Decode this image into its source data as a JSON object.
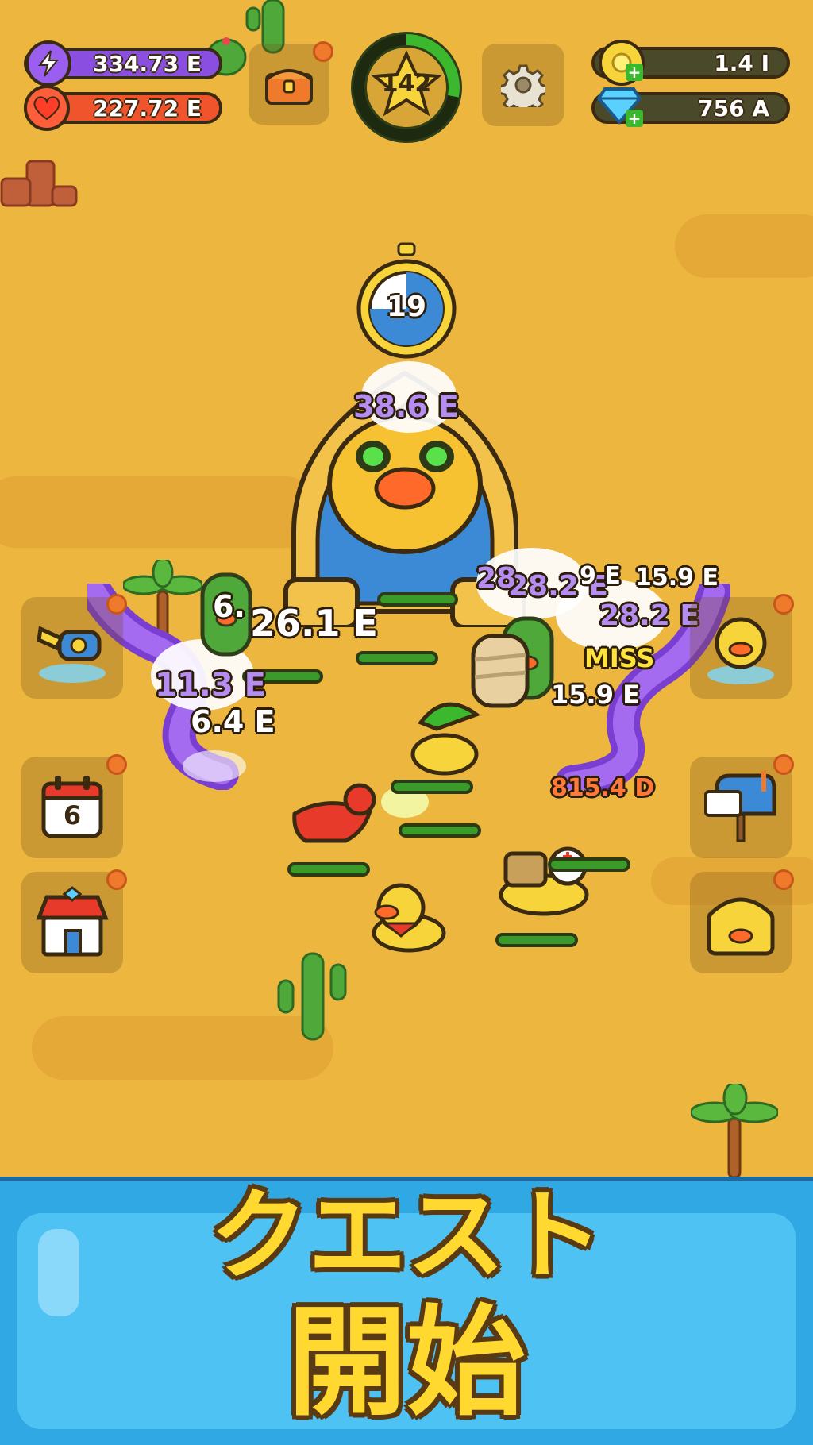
{
  "hud": {
    "energy": {
      "value": "334.73 E",
      "icon": "lightning-icon",
      "color": "#8a4ee0"
    },
    "health": {
      "value": "227.72 E",
      "icon": "heart-icon",
      "color": "#f0542c"
    },
    "level": {
      "value": "142",
      "progress": 0.28,
      "ring_color": "#3bb82e"
    },
    "gold": {
      "value": "1.4 I",
      "icon": "coin-icon"
    },
    "gems": {
      "value": "756 A",
      "icon": "diamond-icon"
    }
  },
  "boss": {
    "timer": "19",
    "name_icon": "sphinx-cat-boss"
  },
  "damage_numbers": {
    "d1": "38.6 E",
    "d2": "28.2 E",
    "d3": "28",
    "d4": "9 E",
    "d5": "15.9 E",
    "d6": "28.2 E",
    "d7": "6.",
    "d8": "26.1 E",
    "d9": "11.3 E",
    "d10": "6.4 E",
    "d11": "MISS",
    "d12": "15.9 E",
    "d13": "815.4 D"
  },
  "side_buttons": {
    "left": [
      {
        "icon": "water-cannon-icon"
      },
      {
        "icon": "calendar-icon",
        "label": "6"
      },
      {
        "icon": "shop-icon"
      }
    ],
    "right": [
      {
        "icon": "duck-swap-icon"
      },
      {
        "icon": "mailbox-icon"
      },
      {
        "icon": "treasure-chest-icon"
      }
    ]
  },
  "quest_banner": {
    "line1": "クエスト",
    "line2": "開始"
  },
  "colors": {
    "sand": "#ecb63f",
    "banner": "#3bb0ea",
    "accent_orange": "#f07a2c"
  }
}
